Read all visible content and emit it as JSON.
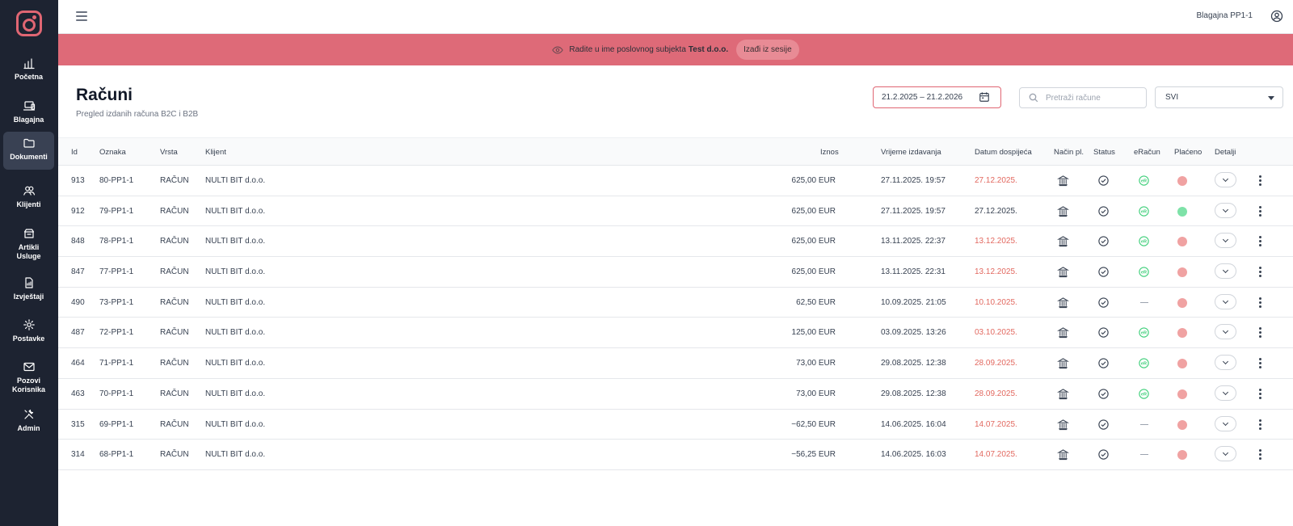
{
  "sidebar": {
    "items": [
      {
        "label": "Početna",
        "icon": "bar-chart-icon"
      },
      {
        "label": "Blagajna",
        "icon": "laptop-icon"
      },
      {
        "label": "Dokumenti",
        "icon": "folder-icon",
        "active": true
      },
      {
        "label": "Klijenti",
        "icon": "users-icon"
      },
      {
        "label": "Artikli\nUsluge",
        "icon": "box-icon"
      },
      {
        "label": "Izvještaji",
        "icon": "report-icon"
      },
      {
        "label": "Postavke",
        "icon": "gear-icon"
      },
      {
        "label": "Pozovi\nKorisnika",
        "icon": "mail-icon"
      },
      {
        "label": "Admin",
        "icon": "tools-icon"
      }
    ]
  },
  "topbar": {
    "cashier": "Blagajna PP1-1"
  },
  "banner": {
    "text": "Radite u ime poslovnog subjekta",
    "company": "Test d.o.o.",
    "exit_label": "Izađi iz sesije"
  },
  "header": {
    "title": "Računi",
    "subtitle": "Pregled izdanih računa B2C i B2B",
    "date_range": "21.2.2025 – 21.2.2026",
    "search_placeholder": "Pretraži račune",
    "filter_value": "SVI"
  },
  "table": {
    "columns": {
      "id": "Id",
      "oznaka": "Oznaka",
      "vrsta": "Vrsta",
      "klijent": "Klijent",
      "iznos": "Iznos",
      "vrijeme": "Vrijeme izdavanja",
      "datum": "Datum dospijeća",
      "nacin": "Način pl.",
      "status": "Status",
      "eracun": "eRačun",
      "placeno": "Plaćeno",
      "detalji": "Detalji"
    },
    "rows": [
      {
        "id": "913",
        "oznaka": "80-PP1-1",
        "vrsta": "RAČUN",
        "klijent": "NULTI BIT d.o.o.",
        "iznos": "625,00 EUR",
        "vrijeme": "27.11.2025. 19:57",
        "datum": "27.12.2025.",
        "overdue": true,
        "eracun": true,
        "paid": false
      },
      {
        "id": "912",
        "oznaka": "79-PP1-1",
        "vrsta": "RAČUN",
        "klijent": "NULTI BIT d.o.o.",
        "iznos": "625,00 EUR",
        "vrijeme": "27.11.2025. 19:57",
        "datum": "27.12.2025.",
        "overdue": false,
        "eracun": true,
        "paid": true
      },
      {
        "id": "848",
        "oznaka": "78-PP1-1",
        "vrsta": "RAČUN",
        "klijent": "NULTI BIT d.o.o.",
        "iznos": "625,00 EUR",
        "vrijeme": "13.11.2025. 22:37",
        "datum": "13.12.2025.",
        "overdue": true,
        "eracun": true,
        "paid": false
      },
      {
        "id": "847",
        "oznaka": "77-PP1-1",
        "vrsta": "RAČUN",
        "klijent": "NULTI BIT d.o.o.",
        "iznos": "625,00 EUR",
        "vrijeme": "13.11.2025. 22:31",
        "datum": "13.12.2025.",
        "overdue": true,
        "eracun": true,
        "paid": false
      },
      {
        "id": "490",
        "oznaka": "73-PP1-1",
        "vrsta": "RAČUN",
        "klijent": "NULTI BIT d.o.o.",
        "iznos": "62,50 EUR",
        "vrijeme": "10.09.2025. 21:05",
        "datum": "10.10.2025.",
        "overdue": true,
        "eracun": false,
        "paid": false
      },
      {
        "id": "487",
        "oznaka": "72-PP1-1",
        "vrsta": "RAČUN",
        "klijent": "NULTI BIT d.o.o.",
        "iznos": "125,00 EUR",
        "vrijeme": "03.09.2025. 13:26",
        "datum": "03.10.2025.",
        "overdue": true,
        "eracun": true,
        "paid": false
      },
      {
        "id": "464",
        "oznaka": "71-PP1-1",
        "vrsta": "RAČUN",
        "klijent": "NULTI BIT d.o.o.",
        "iznos": "73,00 EUR",
        "vrijeme": "29.08.2025. 12:38",
        "datum": "28.09.2025.",
        "overdue": true,
        "eracun": true,
        "paid": false
      },
      {
        "id": "463",
        "oznaka": "70-PP1-1",
        "vrsta": "RAČUN",
        "klijent": "NULTI BIT d.o.o.",
        "iznos": "73,00 EUR",
        "vrijeme": "29.08.2025. 12:38",
        "datum": "28.09.2025.",
        "overdue": true,
        "eracun": true,
        "paid": false
      },
      {
        "id": "315",
        "oznaka": "69-PP1-1",
        "vrsta": "RAČUN",
        "klijent": "NULTI BIT d.o.o.",
        "iznos": "−62,50 EUR",
        "vrijeme": "14.06.2025. 16:04",
        "datum": "14.07.2025.",
        "overdue": true,
        "eracun": false,
        "paid": false
      },
      {
        "id": "314",
        "oznaka": "68-PP1-1",
        "vrsta": "RAČUN",
        "klijent": "NULTI BIT d.o.o.",
        "iznos": "−56,25 EUR",
        "vrijeme": "14.06.2025. 16:03",
        "datum": "14.07.2025.",
        "overdue": true,
        "eracun": false,
        "paid": false
      }
    ]
  },
  "colors": {
    "brand": "#de6a78",
    "sidebar": "#1d2331",
    "overdue": "#e2685f",
    "paid": "#7ee2a8",
    "unpaid": "#f0a2a2",
    "eracun": "#3fcf7a"
  }
}
